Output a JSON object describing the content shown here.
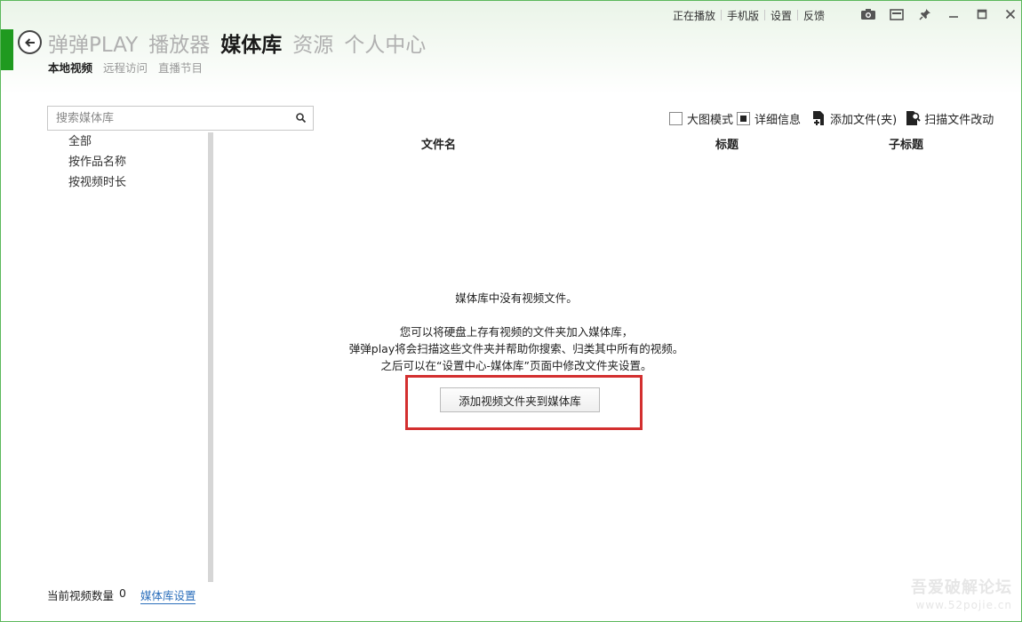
{
  "top_links": [
    "正在播放",
    "手机版",
    "设置",
    "反馈"
  ],
  "window_icons": [
    "camera-icon",
    "screen-icon",
    "pin-icon",
    "minimize-icon",
    "maximize-icon",
    "close-icon"
  ],
  "nav": {
    "main": [
      {
        "label": "弹弹PLAY",
        "active": false
      },
      {
        "label": "播放器",
        "active": false
      },
      {
        "label": "媒体库",
        "active": true
      },
      {
        "label": "资源",
        "active": false
      },
      {
        "label": "个人中心",
        "active": false
      }
    ],
    "sub": [
      {
        "label": "本地视频",
        "active": true
      },
      {
        "label": "远程访问",
        "active": false
      },
      {
        "label": "直播节目",
        "active": false
      }
    ]
  },
  "search": {
    "placeholder": "搜索媒体库",
    "value": ""
  },
  "filters": [
    "全部",
    "按作品名称",
    "按视频时长"
  ],
  "toolbar": {
    "large_mode_label": "大图模式",
    "large_mode_checked": false,
    "details_label": "详细信息",
    "details_checked": true,
    "add_file_label": "添加文件(夹)",
    "scan_label": "扫描文件改动"
  },
  "columns": [
    "文件名",
    "标题",
    "子标题"
  ],
  "empty_state": {
    "title": "媒体库中没有视频文件。",
    "line1": "您可以将硬盘上存有视频的文件夹加入媒体库，",
    "line2": "弹弹play将会扫描这些文件夹并帮助你搜索、归类其中所有的视频。",
    "line3": "之后可以在“设置中心-媒体库”页面中修改文件夹设置。",
    "button_label": "添加视频文件夹到媒体库"
  },
  "footer": {
    "count_label": "当前视频数量",
    "count": "0",
    "settings_link": "媒体库设置"
  },
  "watermark": {
    "text": "吾爱破解论坛",
    "url": "www.52pojie.cn"
  },
  "colors": {
    "accent": "#1f9a1f",
    "highlight": "#d32f2f",
    "link": "#2a6ebb"
  }
}
